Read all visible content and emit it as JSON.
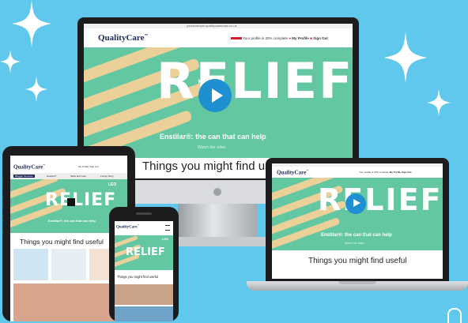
{
  "brand": "QualityCare",
  "trademark": "™",
  "url_bar": "yourexample.qualitycareindex.co.uk",
  "header": {
    "profile_status": "Your profile is 20% complete",
    "my_profile": "My Profile",
    "sign_out": "Sign Out"
  },
  "hero": {
    "title": "RELIEF",
    "tagline": "Enstilar®: the can that can help",
    "sub": "Watch the video"
  },
  "section_title": "Things you might find useful",
  "tablet_nav": [
    "Blogger Services",
    "Enstilar®",
    "Skills and Care",
    "Family Story"
  ],
  "leo_label": "LEO",
  "colors": {
    "background": "#5fc8ec",
    "hero_green": "#63c8a2",
    "stripe": "#ecd09a",
    "play": "#1e8fd0",
    "brand_red": "#d0202a"
  }
}
